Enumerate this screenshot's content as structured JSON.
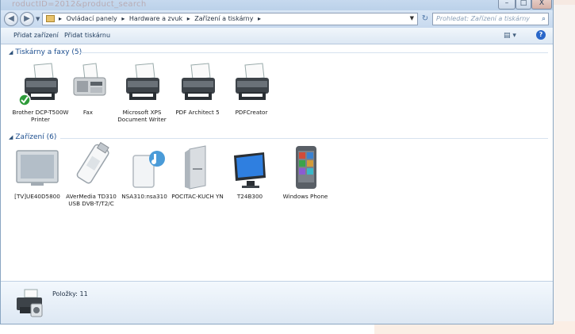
{
  "window": {
    "ghost_title": "roductID=2012&product_search"
  },
  "window_controls": {
    "minimize": "–",
    "maximize": "□",
    "close": "X"
  },
  "address": {
    "crumbs": [
      "Ovládací panely",
      "Hardware a zvuk",
      "Zařízení a tiskárny"
    ],
    "search_placeholder": "Prohledat: Zařízení a tiskárny"
  },
  "toolbar": {
    "add_device": "Přidat zařízení",
    "add_printer": "Přidat tiskárnu"
  },
  "sections": {
    "printers": {
      "title": "Tiskárny a faxy (5)"
    },
    "devices": {
      "title": "Zařízení (6)"
    }
  },
  "printers": [
    {
      "label": "Brother DCP-T500W Printer",
      "icon": "printer-default-icon"
    },
    {
      "label": "Fax",
      "icon": "fax-icon"
    },
    {
      "label": "Microsoft XPS Document Writer",
      "icon": "printer-icon"
    },
    {
      "label": "PDF Architect 5",
      "icon": "printer-icon"
    },
    {
      "label": "PDFCreator",
      "icon": "printer-icon"
    }
  ],
  "devices": [
    {
      "label": "[TV]UE40D5800",
      "icon": "tv-icon"
    },
    {
      "label": "AVerMedia TD310 USB DVB-T/T2/C",
      "icon": "usb-stick-icon"
    },
    {
      "label": "NSA310:nsa310",
      "icon": "media-server-icon"
    },
    {
      "label": "POCITAC-KUCH YN",
      "icon": "computer-tower-icon"
    },
    {
      "label": "T24B300",
      "icon": "monitor-icon"
    },
    {
      "label": "Windows Phone",
      "icon": "phone-icon"
    }
  ],
  "status": {
    "items_label": "Položky: 11"
  }
}
